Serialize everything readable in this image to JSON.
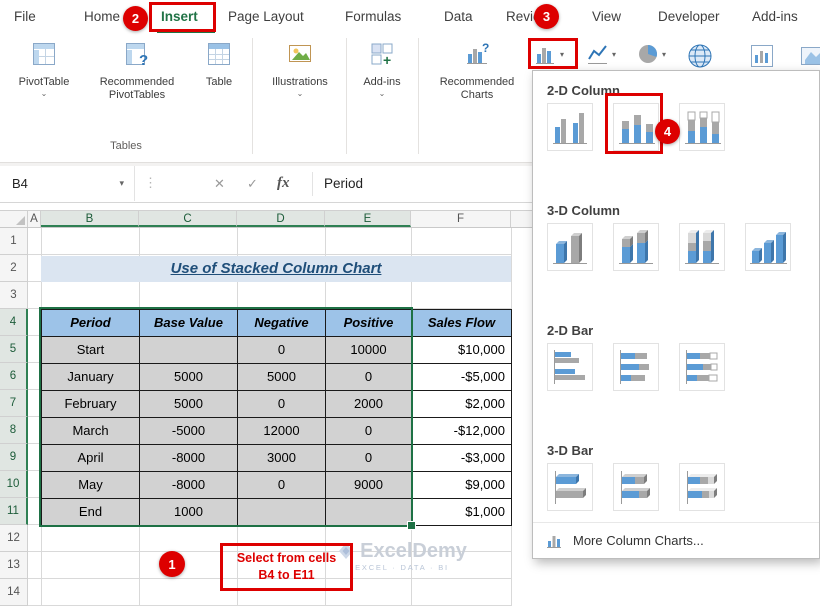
{
  "ribbon": {
    "tabs": [
      "File",
      "Home",
      "Insert",
      "Page Layout",
      "Formulas",
      "Data",
      "Review",
      "View",
      "Developer",
      "Add-ins"
    ],
    "buttons": {
      "pivottable": "PivotTable",
      "recommended_pivottables": "Recommended PivotTables",
      "table": "Table",
      "illustrations": "Illustrations",
      "addins": "Add-ins",
      "recommended_charts": "Recommended Charts"
    },
    "group_labels": {
      "tables": "Tables"
    }
  },
  "formula_bar": {
    "name_box": "B4",
    "fx_label": "fx",
    "formula": "Period"
  },
  "sheet": {
    "column_headers": [
      "A",
      "B",
      "C",
      "D",
      "E",
      "F"
    ],
    "row_headers": [
      "1",
      "2",
      "3",
      "4",
      "5",
      "6",
      "7",
      "8",
      "9",
      "10",
      "11",
      "12",
      "13",
      "14"
    ],
    "title": "Use of Stacked Column Chart",
    "table": {
      "headers": [
        "Period",
        "Base Value",
        "Negative",
        "Positive",
        "Sales Flow"
      ],
      "rows": [
        [
          "Start",
          "",
          "0",
          "10000",
          "$10,000"
        ],
        [
          "January",
          "5000",
          "5000",
          "0",
          "-$5,000"
        ],
        [
          "February",
          "5000",
          "0",
          "2000",
          "$2,000"
        ],
        [
          "March",
          "-5000",
          "12000",
          "0",
          "-$12,000"
        ],
        [
          "April",
          "-8000",
          "3000",
          "0",
          "-$3,000"
        ],
        [
          "May",
          "-8000",
          "0",
          "9000",
          "$9,000"
        ],
        [
          "End",
          "1000",
          "",
          "",
          "$1,000"
        ]
      ]
    }
  },
  "chart_menu": {
    "sections": [
      {
        "title": "2-D Column"
      },
      {
        "title": "3-D Column"
      },
      {
        "title": "2-D Bar"
      },
      {
        "title": "3-D Bar"
      }
    ],
    "more_label": "More Column Charts..."
  },
  "annotations": {
    "step1": "1",
    "step2": "2",
    "step3": "3",
    "step4": "4",
    "note": "Select from cells B4 to E11"
  },
  "watermark": {
    "brand": "ExcelDemy",
    "tagline": "EXCEL · DATA · BI"
  },
  "icons": {
    "chevron_down": "⌄",
    "dropdown_arrow": "▾",
    "cancel": "✕",
    "enter": "✓",
    "separator_dots": "⋮"
  },
  "colors": {
    "accent_green": "#217346",
    "annotation_red": "#dd0000",
    "table_header_fill": "#9dc3e8",
    "title_fill": "#dbe5f1",
    "selection_fill": "#d2d2d2"
  }
}
